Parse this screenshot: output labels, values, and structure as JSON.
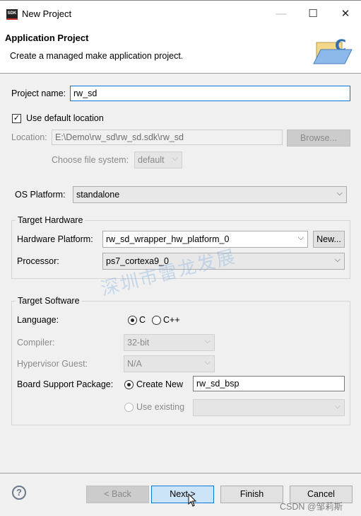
{
  "window": {
    "title": "New Project",
    "app_icon_text": "SDK"
  },
  "header": {
    "title": "Application Project",
    "description": "Create a managed make application project."
  },
  "project": {
    "name_label": "Project name:",
    "name_value": "rw_sd",
    "use_default_label": "Use default location",
    "use_default_checked": true,
    "location_label": "Location:",
    "location_value": "E:\\Demo\\rw_sd\\rw_sd.sdk\\rw_sd",
    "browse_label": "Browse...",
    "filesystem_label": "Choose file system:",
    "filesystem_value": "default"
  },
  "os": {
    "label": "OS Platform:",
    "value": "standalone"
  },
  "hardware": {
    "group_title": "Target Hardware",
    "platform_label": "Hardware Platform:",
    "platform_value": "rw_sd_wrapper_hw_platform_0",
    "new_label": "New...",
    "processor_label": "Processor:",
    "processor_value": "ps7_cortexa9_0"
  },
  "software": {
    "group_title": "Target Software",
    "language_label": "Language:",
    "lang_c": "C",
    "lang_cpp": "C++",
    "selected_language": "C",
    "compiler_label": "Compiler:",
    "compiler_value": "32-bit",
    "hypervisor_label": "Hypervisor Guest:",
    "hypervisor_value": "N/A",
    "bsp_label": "Board Support Package:",
    "create_new_label": "Create New",
    "bsp_value": "rw_sd_bsp",
    "use_existing_label": "Use existing",
    "use_existing_value": ""
  },
  "footer": {
    "back": "< Back",
    "next": "Next >",
    "finish": "Finish",
    "cancel": "Cancel"
  },
  "watermarks": {
    "center": "深圳市雷龙发展",
    "corner": "CSDN @邹莉斯"
  }
}
